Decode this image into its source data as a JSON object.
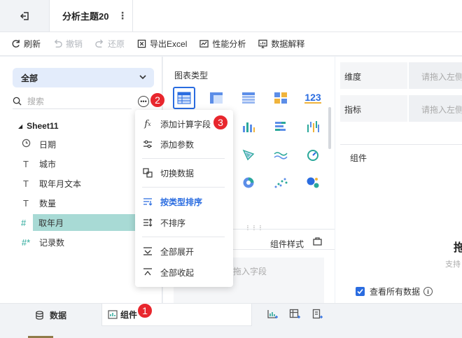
{
  "header": {
    "tab_title": "分析主题20",
    "tab_more": "⋮"
  },
  "toolbar": {
    "refresh": "刷新",
    "undo": "撤销",
    "redo": "还原",
    "export": "导出Excel",
    "perf": "性能分析",
    "explain": "数据解释"
  },
  "left": {
    "scope": "全部",
    "search_placeholder": "搜索",
    "more": "•••",
    "sheet": "Sheet11",
    "fields": [
      {
        "icon": "clock-icon",
        "label": "日期"
      },
      {
        "icon": "text-type-icon",
        "label": "城市"
      },
      {
        "icon": "text-type-icon",
        "label": "取年月文本"
      },
      {
        "icon": "text-type-icon",
        "label": "数量"
      },
      {
        "icon": "number-type-icon",
        "label": "取年月"
      },
      {
        "icon": "number-calc-icon",
        "label": "记录数"
      }
    ]
  },
  "middle": {
    "title": "图表类型",
    "number_chart_label": "123",
    "style_tab": "组件样式",
    "drop_hint": "拖入字段"
  },
  "right": {
    "dim_label": "维度",
    "dim_hint": "请拖入左侧字",
    "measure_label": "指标",
    "measure_hint": "请拖入左侧字",
    "component_title": "组件",
    "big": "拖",
    "support": "支持",
    "view_all": "查看所有数据"
  },
  "menu": {
    "items": [
      {
        "icon": "fx-icon",
        "label": "添加计算字段"
      },
      {
        "icon": "sliders-icon",
        "label": "添加参数"
      },
      {
        "icon": "switch-data-icon",
        "label": "切换数据"
      },
      {
        "icon": "sort-type-icon",
        "label": "按类型排序"
      },
      {
        "icon": "no-sort-icon",
        "label": "不排序"
      },
      {
        "icon": "expand-all-icon",
        "label": "全部展开"
      },
      {
        "icon": "collapse-all-icon",
        "label": "全部收起"
      }
    ]
  },
  "bottom": {
    "data_tab": "数据",
    "component_tab": "组件"
  },
  "badges": [
    "1",
    "2",
    "3"
  ],
  "colors": {
    "accent": "#2a6ce0",
    "highlight": "#a8dad5",
    "badge": "#e8262d"
  }
}
